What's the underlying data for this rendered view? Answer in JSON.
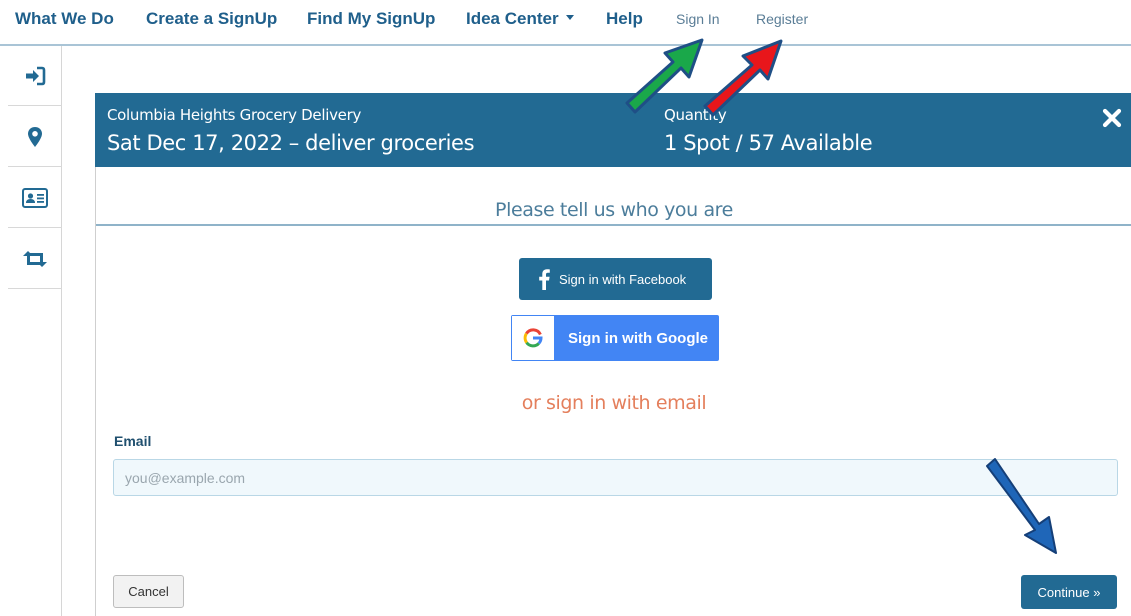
{
  "nav": {
    "items": [
      "What We Do",
      "Create a SignUp",
      "Find My SignUp",
      "Idea Center",
      "Help"
    ],
    "sign_in": "Sign In",
    "register": "Register"
  },
  "sidebar": {
    "icons": [
      "sign-in-icon",
      "map-marker-icon",
      "contact-card-icon",
      "retweet-icon"
    ]
  },
  "modal": {
    "event_name": "Columbia Heights Grocery Delivery",
    "event_date": "Sat Dec 17, 2022 – deliver groceries",
    "quantity_label": "Quantity",
    "quantity_value": "1 Spot / 57 Available",
    "section_title": "Please tell us who you are",
    "facebook_label": "Sign in with Facebook",
    "google_label": "Sign in with Google",
    "or_email": "or sign in with email",
    "email_label": "Email",
    "email_placeholder": "you@example.com",
    "email_value": "",
    "cancel_label": "Cancel",
    "continue_label": "Continue »"
  },
  "colors": {
    "brand": "#226a93",
    "nav_text": "#1f5f8b",
    "accent_orange": "#e47f5c",
    "google_blue": "#4285f4",
    "arrow_green": "#1aa84a",
    "arrow_red": "#e8161b",
    "arrow_blue": "#1f66b8"
  }
}
